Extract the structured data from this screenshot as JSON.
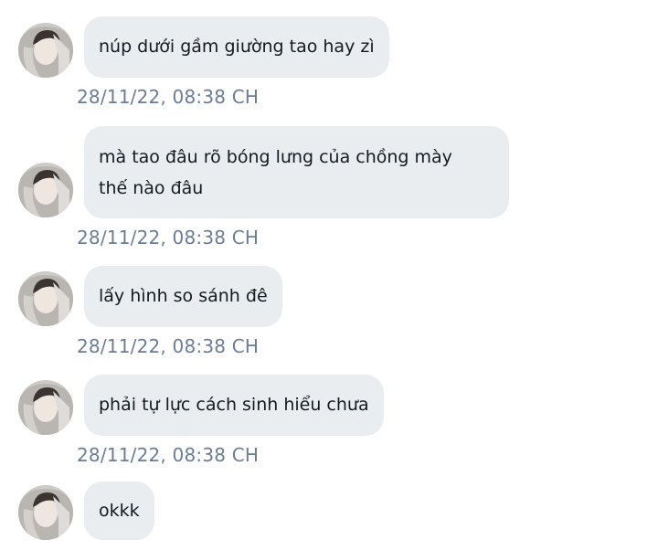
{
  "messages": [
    {
      "text": "núp dưới gầm giường tao hay zì",
      "time": "28/11/22,  08:38 CH"
    },
    {
      "lines": [
        "mà tao đâu rõ bóng lưng của chồng mày",
        "thế nào đâu"
      ],
      "time": "28/11/22,  08:38 CH"
    },
    {
      "text": "lấy hình so sánh đê",
      "time": "28/11/22,  08:38 CH"
    },
    {
      "text": "phải tự lực cách sinh hiểu chưa",
      "time": "28/11/22,  08:38 CH"
    },
    {
      "text": "okkk"
    }
  ],
  "colors": {
    "bubble": "#e9edf0",
    "timestamp": "#6b7d96",
    "text": "#111b21"
  },
  "icons": {
    "avatar": "user-avatar-photo"
  }
}
